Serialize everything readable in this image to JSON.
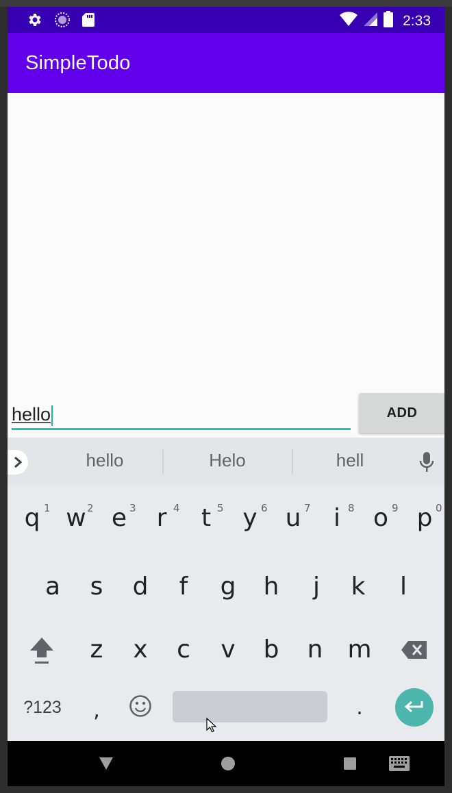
{
  "status_bar": {
    "time": "2:33",
    "icons_left": [
      "settings-icon",
      "sync-icon",
      "sd-card-icon"
    ],
    "icons_right": [
      "wifi-icon",
      "signal-icon",
      "battery-icon"
    ]
  },
  "app_bar": {
    "title": "SimpleTodo"
  },
  "input": {
    "value": "hello"
  },
  "add_button": {
    "label": "ADD"
  },
  "keyboard": {
    "suggestions": [
      "hello",
      "Helo",
      "hell"
    ],
    "row1": [
      {
        "letter": "q",
        "num": "1"
      },
      {
        "letter": "w",
        "num": "2"
      },
      {
        "letter": "e",
        "num": "3"
      },
      {
        "letter": "r",
        "num": "4"
      },
      {
        "letter": "t",
        "num": "5"
      },
      {
        "letter": "y",
        "num": "6"
      },
      {
        "letter": "u",
        "num": "7"
      },
      {
        "letter": "i",
        "num": "8"
      },
      {
        "letter": "o",
        "num": "9"
      },
      {
        "letter": "p",
        "num": "0"
      }
    ],
    "row2": [
      "a",
      "s",
      "d",
      "f",
      "g",
      "h",
      "j",
      "k",
      "l"
    ],
    "row3": [
      "z",
      "x",
      "c",
      "v",
      "b",
      "n",
      "m"
    ],
    "symbols_label": "?123",
    "comma": ",",
    "period": "."
  },
  "colors": {
    "status_bar": "#3700b3",
    "app_bar": "#6200ee",
    "accent": "#1ec5b5",
    "enter_key": "#4db6ac"
  }
}
